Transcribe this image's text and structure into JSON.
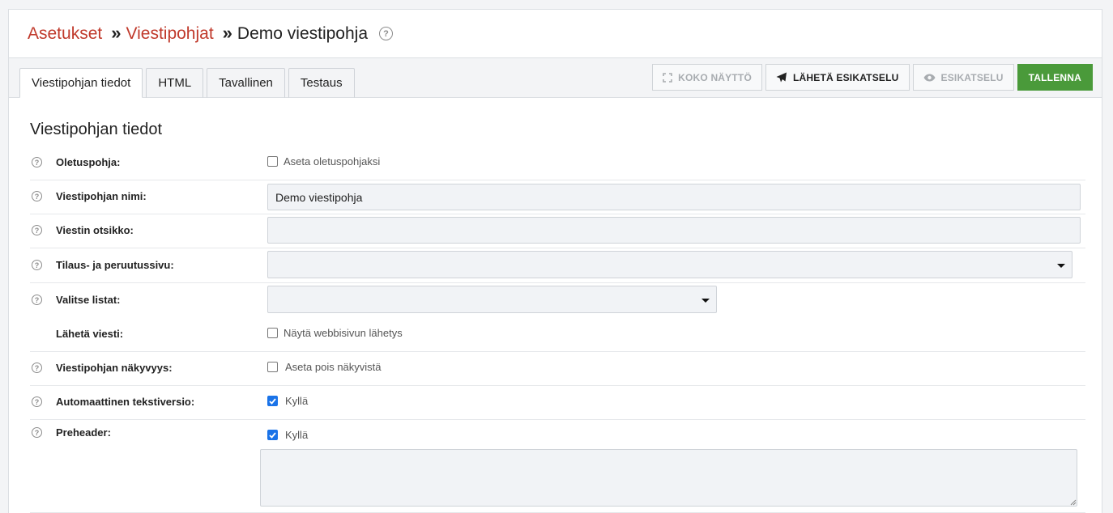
{
  "breadcrumb": {
    "items": [
      "Asetukset",
      "Viestipohjat"
    ],
    "current": "Demo viestipohja",
    "separator": "»"
  },
  "tabs": [
    {
      "label": "Viestipohjan tiedot",
      "active": true
    },
    {
      "label": "HTML",
      "active": false
    },
    {
      "label": "Tavallinen",
      "active": false
    },
    {
      "label": "Testaus",
      "active": false
    }
  ],
  "actions": {
    "fullscreen": "KOKO NÄYTTÖ",
    "send_preview": "LÄHETÄ ESIKATSELU",
    "preview": "ESIKATSELU",
    "save": "TALLENNA"
  },
  "section_title": "Viestipohjan tiedot",
  "fields": {
    "default_template": {
      "label": "Oletuspohja:",
      "option": "Aseta oletuspohjaksi",
      "checked": false
    },
    "template_name": {
      "label": "Viestipohjan nimi:",
      "value": "Demo viestipohja"
    },
    "subject": {
      "label": "Viestin otsikko:",
      "value": ""
    },
    "subscribe_page": {
      "label": "Tilaus- ja peruutussivu:",
      "value": ""
    },
    "lists": {
      "label": "Valitse listat:",
      "value": ""
    },
    "send_message": {
      "label": "Lähetä viesti:",
      "option": "Näytä webbisivun lähetys",
      "checked": false
    },
    "visibility": {
      "label": "Viestipohjan näkyvyys:",
      "option": "Aseta pois näkyvistä",
      "checked": false
    },
    "auto_text": {
      "label": "Automaattinen tekstiversio:",
      "option": "Kyllä",
      "checked": true
    },
    "preheader": {
      "label": "Preheader:",
      "option": "Kyllä",
      "checked": true,
      "value": ""
    }
  },
  "colors": {
    "breadcrumb_link": "#c0392b",
    "save_button": "#4a9a3a",
    "checkbox_checked": "#1a73e8"
  }
}
